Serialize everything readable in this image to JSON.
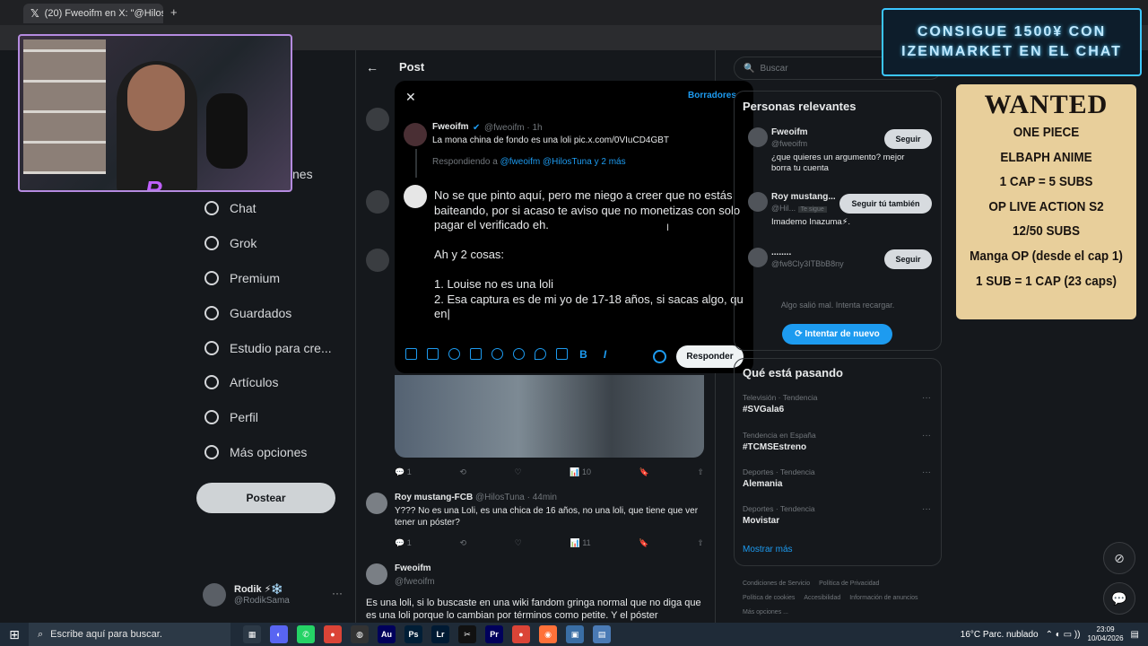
{
  "browser": {
    "tab_title": "(20) Fweoifm en X: \"@HilosTuna",
    "tab_close": "✕",
    "new_tab": "+"
  },
  "nav": {
    "partial_label": "nes",
    "items": [
      {
        "name": "chat",
        "label": "Chat",
        "icon": "chat-icon"
      },
      {
        "name": "grok",
        "label": "Grok",
        "icon": "grok-icon"
      },
      {
        "name": "premium",
        "label": "Premium",
        "icon": "premium-icon"
      },
      {
        "name": "guardados",
        "label": "Guardados",
        "icon": "bookmark-icon"
      },
      {
        "name": "estudio",
        "label": "Estudio para cre...",
        "icon": "rocket-icon"
      },
      {
        "name": "articulos",
        "label": "Artículos",
        "icon": "article-icon"
      },
      {
        "name": "perfil",
        "label": "Perfil",
        "icon": "profile-icon"
      },
      {
        "name": "mas",
        "label": "Más opciones",
        "icon": "more-icon"
      }
    ],
    "post_button": "Postear"
  },
  "account": {
    "name": "Rodik ⚡❄️",
    "handle": "@RodikSama",
    "menu": "···"
  },
  "header": {
    "back": "←",
    "title": "Post"
  },
  "compose": {
    "close": "✕",
    "drafts": "Borradores",
    "original_name": "Fweoifm",
    "original_meta": "@fweoifm · 1h",
    "original_text": "La mona china de fondo es una loli pic.x.com/0VIuCD4GBT",
    "replying_prefix": "Respondiendo a",
    "replying_to": "@fweoifm @HilosTuna y 2 más",
    "draft_text": "No se que pinto aquí, pero me niego a creer que no estás baiteando, por si acaso te aviso que no monetizas con solo pagar el verificado eh.\n\nAh y 2 cosas:\n\n1. Louise no es una loli\n2. Esa captura es de mi yo de 17-18 años, si sacas algo, qu en|",
    "reply_button": "Responder",
    "text_cursor": "I"
  },
  "feed": {
    "action_counts_1": {
      "replies": "1",
      "views": "10"
    },
    "tweet_roy": {
      "name": "Roy mustang-FCB",
      "meta": "@HilosTuna · 44min",
      "text": "Y??? No es una Loli, es una chica de 16 años, no una loli, que tiene que ver tener un póster?",
      "replies": "1",
      "views": "11"
    },
    "tweet_fweoifm": {
      "name": "Fweoifm",
      "handle": "@fweoifm",
      "text": "Es una loli, si lo buscaste en una wiki fandom gringa normal que no diga que es una loli porque lo cambian por términos como petite. Y el póster"
    }
  },
  "sidebar": {
    "search_placeholder": "Buscar",
    "relevant_title": "Personas relevantes",
    "people": [
      {
        "name": "Fweoifm",
        "handle": "@fweoifm",
        "bio": "¿que quieres un argumento? mejor borra tu cuenta",
        "button": "Seguir"
      },
      {
        "name": "Roy mustang...",
        "handle": "@Hil...",
        "badge": "Te sigue",
        "bio": "Imademo Inazuma⚡.",
        "button": "Seguir tú también"
      },
      {
        "name": "........",
        "handle": "@fw8Cly3ITBbB8ny",
        "bio": "",
        "button": "Seguir"
      }
    ],
    "error_text": "Algo salió mal. Intenta recargar.",
    "retry_button": "Intentar de nuevo",
    "trends_title": "Qué está pasando",
    "trends": [
      {
        "context": "Televisión · Tendencia",
        "name": "#SVGala6"
      },
      {
        "context": "Tendencia en España",
        "name": "#TCMSEstreno"
      },
      {
        "context": "Deportes · Tendencia",
        "name": "Alemania"
      },
      {
        "context": "Deportes · Tendencia",
        "name": "Movistar"
      }
    ],
    "show_more": "Mostrar más",
    "footer": [
      "Condiciones de Servicio",
      "Política de Privacidad",
      "Política de cookies",
      "Accesibilidad",
      "Información de anuncios",
      "Más opciones ..."
    ]
  },
  "overlay": {
    "banner_line1": "CONSIGUE 1500¥ CON",
    "banner_line2": "IZENMARKET EN EL CHAT",
    "wanted_title": "WANTED",
    "wanted_lines": [
      "ONE PIECE",
      "ELBAPH ANIME",
      "1 CAP = 5 SUBS",
      "OP LIVE ACTION S2",
      "12/50 SUBS",
      "Manga OP (desde el cap 1)",
      "1 SUB = 1 CAP (23 caps)"
    ],
    "streamer_logo": "R"
  },
  "taskbar": {
    "search_placeholder": "Escribe aquí para buscar.",
    "weather": "16°C  Parc. nublado",
    "time": "23:09",
    "date": "10/04/2026",
    "apps": [
      {
        "label": "▦",
        "color": "#2c3946"
      },
      {
        "label": "◐",
        "color": "#5865f2"
      },
      {
        "label": "✆",
        "color": "#25d366"
      },
      {
        "label": "●",
        "color": "#db4437"
      },
      {
        "label": "◍",
        "color": "#333"
      },
      {
        "label": "Au",
        "color": "#00005b"
      },
      {
        "label": "Ps",
        "color": "#001e36"
      },
      {
        "label": "Lr",
        "color": "#001a33"
      },
      {
        "label": "✂",
        "color": "#111"
      },
      {
        "label": "Pr",
        "color": "#00005b"
      },
      {
        "label": "●",
        "color": "#db4437"
      },
      {
        "label": "◉",
        "color": "#ff7139"
      },
      {
        "label": "▣",
        "color": "#3a6ea5"
      },
      {
        "label": "▤",
        "color": "#4a7ab5"
      }
    ]
  }
}
